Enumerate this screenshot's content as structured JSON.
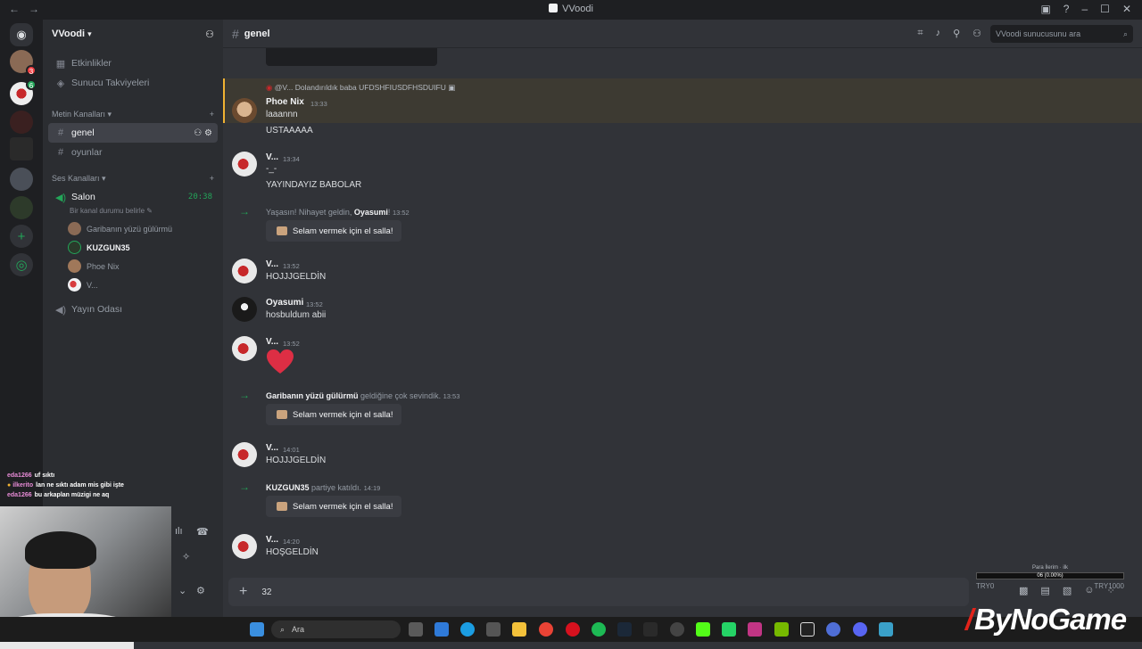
{
  "window": {
    "title": "VVoodi",
    "nav_back": "←",
    "nav_fwd": "→"
  },
  "server": {
    "name": "VVoodi"
  },
  "sidebar": {
    "top_items": [
      {
        "label": "Etkinlikler"
      },
      {
        "label": "Sunucu Takviyeleri"
      }
    ],
    "text_category": "Metin Kanalları",
    "text_channels": [
      {
        "label": "genel"
      },
      {
        "label": "oyunlar"
      }
    ],
    "voice_category": "Ses Kanalları",
    "voice_channel": {
      "label": "Salon",
      "timer": "20:38",
      "status": "Bir kanal durumu belirle"
    },
    "voice_users": [
      "Garibanın yüzü gülürmü",
      "KUZGUN35",
      "Phoe Nix",
      "V..."
    ],
    "stage_channel": "Yayın Odası"
  },
  "header": {
    "channel": "genel",
    "search_placeholder": "VVoodi sunucusunu ara"
  },
  "messages": {
    "reply": {
      "text": "@V... Dolandırıldık baba UFDSHFIUSDFHSDUIFU"
    },
    "m1": {
      "author": "Phoe Nix",
      "time": "13:33",
      "line1": "laaannn",
      "line2": "USTAAAAA"
    },
    "m2": {
      "author": "V...",
      "time": "13:34",
      "line1": "-_-",
      "line2": "YAYINDAYIZ BABOLAR"
    },
    "s1": {
      "pre": "Yaşasın! Nihayet geldin, ",
      "user": "Oyasumi",
      "post": "!",
      "time": "13:52",
      "button": "Selam vermek için el salla!"
    },
    "m3": {
      "author": "V...",
      "time": "13:52",
      "line1": "HOJJJGELDİN"
    },
    "m4": {
      "author": "Oyasumi",
      "time": "13:52",
      "line1": "hosbuldum abii"
    },
    "m5": {
      "author": "V...",
      "time": "13:52"
    },
    "s2": {
      "user": "Garibanın yüzü gülürmü",
      "post": " geldiğine çok sevindik.",
      "time": "13:53",
      "button": "Selam vermek için el salla!"
    },
    "m6": {
      "author": "V...",
      "time": "14:01",
      "line1": "HOJJJGELDİN"
    },
    "s3": {
      "user": "KUZGUN35",
      "post": " partiye katıldı.",
      "time": "14:19",
      "button": "Selam vermek için el salla!"
    },
    "m7": {
      "author": "V...",
      "time": "14:20",
      "line1": "HOŞGELDİN"
    }
  },
  "composer": {
    "value": "32"
  },
  "donation": {
    "title": "Para İlerim · ilk",
    "bar": "06 (0.00%)",
    "min": "TRY0",
    "max": "TRY1000"
  },
  "stream_chat": [
    {
      "user": "eda1266",
      "text": "uf sıktı"
    },
    {
      "user": "ilkerito",
      "text": "lan ne sıktı adam mis gibi işte"
    },
    {
      "user": "eda1266",
      "text": "bu arkaplan müzigi ne aq"
    }
  ],
  "taskbar": {
    "search": "Ara"
  },
  "watermark": "ByNoGame",
  "colors": {
    "accent_green": "#23a559",
    "mention_bar": "#f0b232",
    "badge_red": "#f23f43"
  }
}
